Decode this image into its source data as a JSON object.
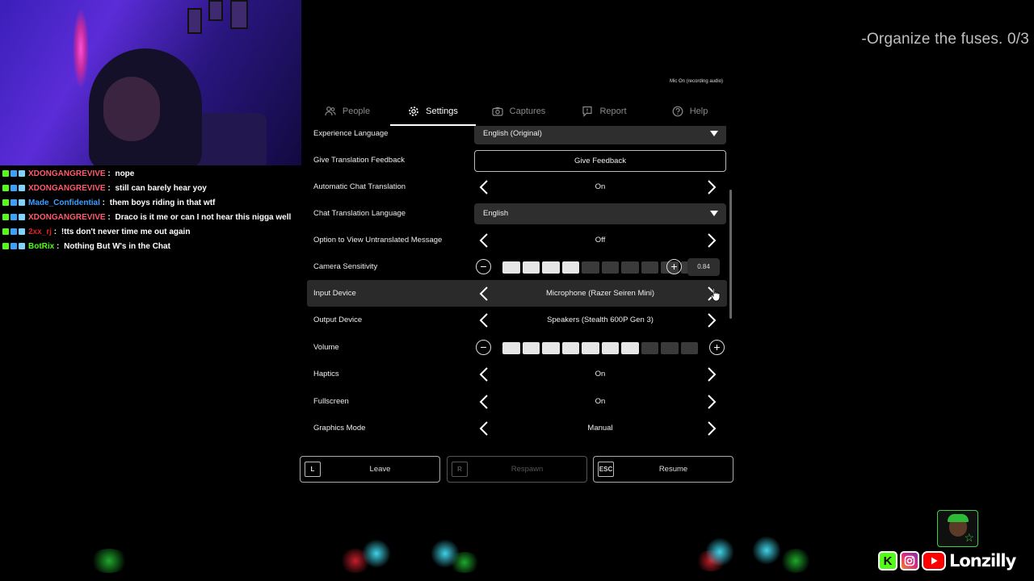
{
  "quest": {
    "text": "-Organize the fuses. 0/3"
  },
  "mic_status": "Mic On (recording audio)",
  "tabs": [
    {
      "label": "People",
      "icon": "people-icon",
      "active": false
    },
    {
      "label": "Settings",
      "icon": "gear-icon",
      "active": true
    },
    {
      "label": "Captures",
      "icon": "camera-icon",
      "active": false
    },
    {
      "label": "Report",
      "icon": "flag-icon",
      "active": false
    },
    {
      "label": "Help",
      "icon": "question-icon",
      "active": false
    }
  ],
  "settings": {
    "experience_language": {
      "label": "Experience Language",
      "value": "English (Original)"
    },
    "translation_feedback": {
      "label": "Give Translation Feedback",
      "button": "Give Feedback"
    },
    "auto_chat_translation": {
      "label": "Automatic Chat Translation",
      "value": "On"
    },
    "chat_translation_language": {
      "label": "Chat Translation Language",
      "value": "English"
    },
    "untranslated_message": {
      "label": "Option to View Untranslated Message",
      "value": "Off"
    },
    "camera_sensitivity": {
      "label": "Camera Sensitivity",
      "value": "0.84",
      "filled_segments": 4,
      "total_segments": 10
    },
    "input_device": {
      "label": "Input Device",
      "value": "Microphone (Razer Seiren Mini)"
    },
    "output_device": {
      "label": "Output Device",
      "value": "Speakers (Stealth 600P Gen 3)"
    },
    "volume": {
      "label": "Volume",
      "filled_segments": 7,
      "total_segments": 10
    },
    "haptics": {
      "label": "Haptics",
      "value": "On"
    },
    "fullscreen": {
      "label": "Fullscreen",
      "value": "On"
    },
    "graphics_mode": {
      "label": "Graphics Mode",
      "value": "Manual"
    }
  },
  "bottom_buttons": {
    "leave": {
      "key": "L",
      "label": "Leave"
    },
    "respawn": {
      "key": "R",
      "label": "Respawn"
    },
    "resume": {
      "key": "ESC",
      "label": "Resume"
    }
  },
  "chat": [
    {
      "user": "XDONGANGREVIVE",
      "color": "#ff5a6e",
      "message": "nope"
    },
    {
      "user": "XDONGANGREVIVE",
      "color": "#ff5a6e",
      "message": "still can barely hear yoy"
    },
    {
      "user": "Made_Confidential",
      "color": "#3aa0ff",
      "message": "them boys riding in that wtf"
    },
    {
      "user": "XDONGANGREVIVE",
      "color": "#ff5a6e",
      "message": "Draco is it me or can I not hear this nigga well"
    },
    {
      "user": "2xx_rj",
      "color": "#d22",
      "message": "!tts don't never time me out again"
    },
    {
      "user": "BotRix",
      "color": "#53fc18",
      "message": "Nothing But W's in the Chat"
    }
  ],
  "socials": {
    "name": "Lonzilly"
  }
}
